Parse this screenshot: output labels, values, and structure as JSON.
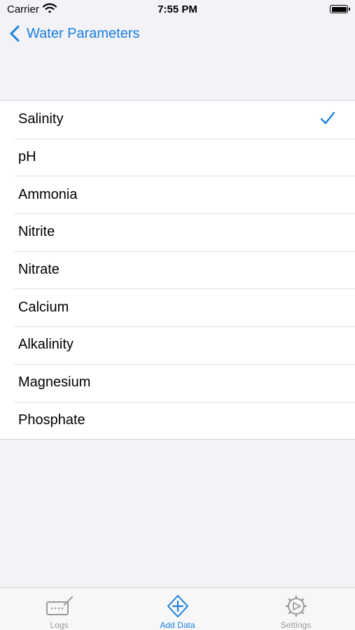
{
  "status_bar": {
    "carrier": "Carrier",
    "time": "7:55 PM"
  },
  "nav": {
    "back_label": "Water Parameters"
  },
  "list": {
    "items": [
      {
        "label": "Salinity",
        "selected": true
      },
      {
        "label": "pH",
        "selected": false
      },
      {
        "label": "Ammonia",
        "selected": false
      },
      {
        "label": "Nitrite",
        "selected": false
      },
      {
        "label": "Nitrate",
        "selected": false
      },
      {
        "label": "Calcium",
        "selected": false
      },
      {
        "label": "Alkalinity",
        "selected": false
      },
      {
        "label": "Magnesium",
        "selected": false
      },
      {
        "label": "Phosphate",
        "selected": false
      }
    ]
  },
  "tabs": [
    {
      "label": "Logs",
      "icon": "logs-icon"
    },
    {
      "label": "Add Data",
      "icon": "add-data-icon",
      "active": true
    },
    {
      "label": "Settings",
      "icon": "settings-icon"
    }
  ],
  "colors": {
    "accent": "#1a7fdd",
    "background": "#f2f2f7",
    "inactive": "#9a9a9a"
  }
}
